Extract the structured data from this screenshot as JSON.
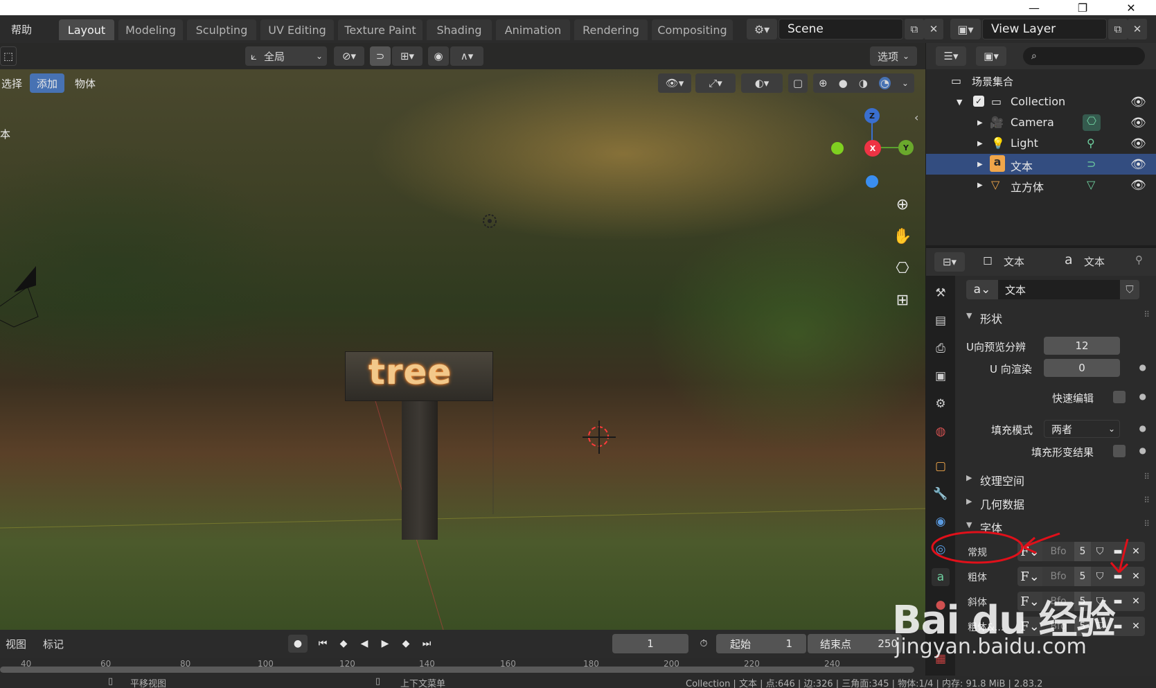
{
  "window": {
    "minimize": "—",
    "restore": "❐",
    "close": "✕"
  },
  "topbar": {
    "help_menu": "帮助",
    "tabs": [
      "Layout",
      "Modeling",
      "Sculpting",
      "UV Editing",
      "Texture Paint",
      "Shading",
      "Animation",
      "Rendering",
      "Compositing"
    ],
    "active_tab": "Layout",
    "scene_label": "Scene",
    "view_layer_label": "View Layer"
  },
  "viewport_header": {
    "transform_orientation": "全局",
    "options_label": "选项",
    "menu_items": [
      "选择",
      "添加",
      "物体"
    ],
    "active_menu": "添加",
    "side_text": "本"
  },
  "scene_text": {
    "sign_text": "tree"
  },
  "gizmo": {
    "z": "Z",
    "x": "X",
    "y": "Y"
  },
  "timeline": {
    "menus": [
      "视图",
      "标记"
    ],
    "current_frame": "1",
    "start_label": "起始",
    "start_frame": "1",
    "end_label": "结束点",
    "end_frame": "250",
    "ruler": [
      "40",
      "60",
      "80",
      "100",
      "120",
      "140",
      "160",
      "180",
      "200",
      "220",
      "240"
    ]
  },
  "status": {
    "left": "平移视图",
    "middle": "上下文菜单",
    "right": "Collection | 文本 | 点:646 | 边:326 | 三角面:345 | 物体:1/4 | 内存: 91.8 MiB | 2.83.2"
  },
  "outliner": {
    "root": "场景集合",
    "collection": "Collection",
    "items": [
      {
        "name": "Camera",
        "icon": "camera-icon"
      },
      {
        "name": "Light",
        "icon": "light-icon"
      },
      {
        "name": "文本",
        "icon": "text-icon",
        "selected": true
      },
      {
        "name": "立方体",
        "icon": "mesh-icon"
      }
    ]
  },
  "properties": {
    "header_object": "文本",
    "header_data": "文本",
    "datablock_name": "文本",
    "sections": {
      "shape": "形状",
      "texture_space": "纹理空间",
      "geometry": "几何数据",
      "font": "字体"
    },
    "fields": {
      "u_preview_label": "U向预览分辨",
      "u_preview_value": "12",
      "u_render_label": "U 向渲染",
      "u_render_value": "0",
      "fast_edit_label": "快速编辑",
      "fill_mode_label": "填充模式",
      "fill_mode_value": "两者",
      "fill_deform_label": "填充形变结果"
    },
    "font_rows": [
      {
        "label": "常规",
        "font": "Bfo",
        "users": "5"
      },
      {
        "label": "粗体",
        "font": "Bfo",
        "users": "5"
      },
      {
        "label": "斜体",
        "font": "Bfo",
        "users": "5"
      },
      {
        "label": "粗体&...",
        "font": "Bfo",
        "users": "5"
      }
    ]
  },
  "watermark": {
    "brand": "Bai du 经验",
    "url": "jingyan.baidu.com"
  },
  "colors": {
    "accent": "#4772b3",
    "selected_row": "#334d80",
    "text_object": "#f0a64a"
  }
}
